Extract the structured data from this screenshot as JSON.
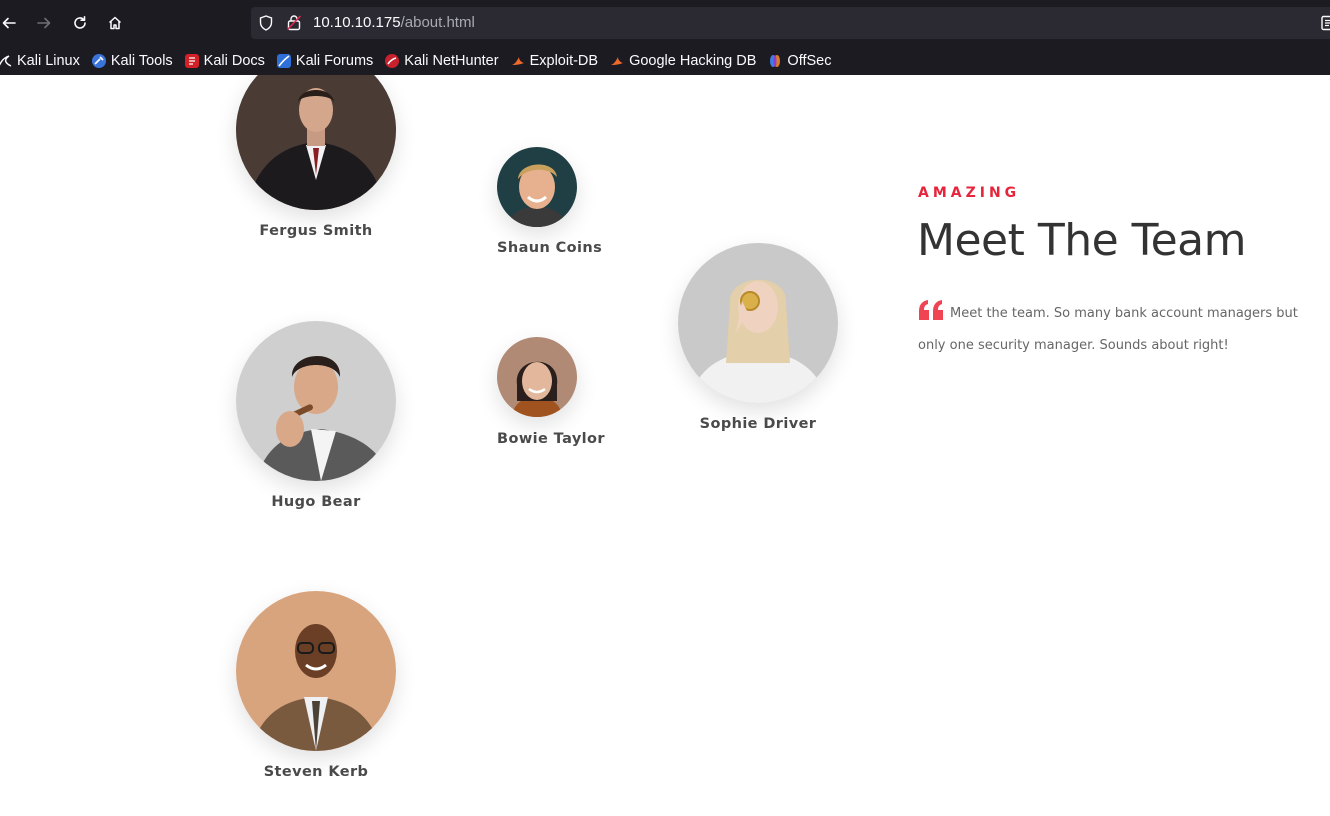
{
  "browser": {
    "url_host": "10.10.10.175",
    "url_path": "/about.html",
    "bookmarks": [
      {
        "label": "Kali Linux",
        "icon": "kali-dragon-icon"
      },
      {
        "label": "Kali Tools",
        "icon": "kali-tools-icon"
      },
      {
        "label": "Kali Docs",
        "icon": "kali-docs-icon"
      },
      {
        "label": "Kali Forums",
        "icon": "kali-forums-icon"
      },
      {
        "label": "Kali NetHunter",
        "icon": "kali-nethunter-icon"
      },
      {
        "label": "Exploit-DB",
        "icon": "exploit-db-icon"
      },
      {
        "label": "Google Hacking DB",
        "icon": "exploit-db-icon"
      },
      {
        "label": "OffSec",
        "icon": "offsec-icon"
      }
    ]
  },
  "team": {
    "eyebrow": "AMAZING",
    "title": "Meet The Team",
    "quote": "Meet the team. So many bank account managers but only one security manager. Sounds about right!",
    "accent_color": "#e6243b",
    "members": [
      {
        "name": "Fergus Smith"
      },
      {
        "name": "Shaun Coins"
      },
      {
        "name": "Sophie Driver"
      },
      {
        "name": "Hugo Bear"
      },
      {
        "name": "Bowie Taylor"
      },
      {
        "name": "Steven Kerb"
      }
    ]
  }
}
